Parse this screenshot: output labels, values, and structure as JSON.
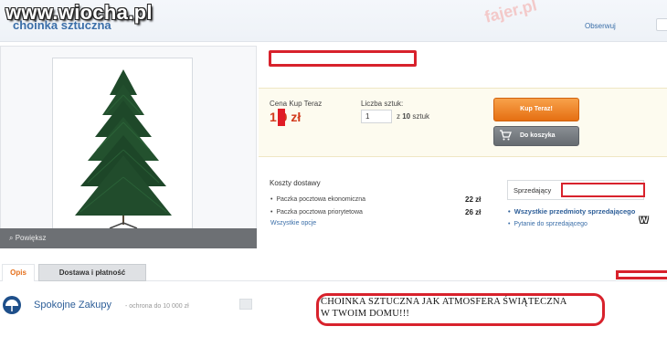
{
  "watermark": "www.wiocha.pl",
  "header": {
    "page_title": "choinka sztuczna",
    "bg_watermark": "fajer.pl",
    "watch_link": "Obserwuj"
  },
  "gallery": {
    "zoom_label": "Powiększ",
    "photo_icon": "christmas-tree-photo"
  },
  "buy_box": {
    "price_label": "Cena Kup Teraz",
    "price_value": "1  0 zł",
    "quantity_label": "Liczba sztuk:",
    "quantity_value": "1",
    "quantity_of_prefix": "z",
    "quantity_max": "10",
    "quantity_unit": "sztuk",
    "buy_now_label": "Kup Teraz!",
    "add_to_cart_label": "Do koszyka",
    "buy_now_color": "#e56f12"
  },
  "shipping": {
    "title": "Koszty dostawy",
    "options": [
      {
        "name": "Paczka pocztowa ekonomiczna",
        "price": "22 zł"
      },
      {
        "name": "Paczka pocztowa priorytetowa",
        "price": "26 zł"
      }
    ],
    "all_options_link": "Wszystkie opcje"
  },
  "seller": {
    "label": "Sprzedający",
    "all_items_link": "Wszystkie przedmioty sprzedającego",
    "ask_link": "Pytanie do sprzedającego"
  },
  "tabs": [
    {
      "label": "Opis",
      "active": true
    },
    {
      "label": "Dostawa i płatność",
      "active": false
    }
  ],
  "safe_shopping": {
    "title": "Spokojne Zakupy",
    "subtitle": "- ochrona do 10 000 zł"
  },
  "description": {
    "line1": "CHOINKA SZTUCZNA JAK ATMOSFERA ŚWIĄTECZNA",
    "line2": "W TWOIM DOMU!!!"
  },
  "colors": {
    "redaction": "#d8222c",
    "link": "#3a6ea8",
    "price": "#d23a1c"
  }
}
